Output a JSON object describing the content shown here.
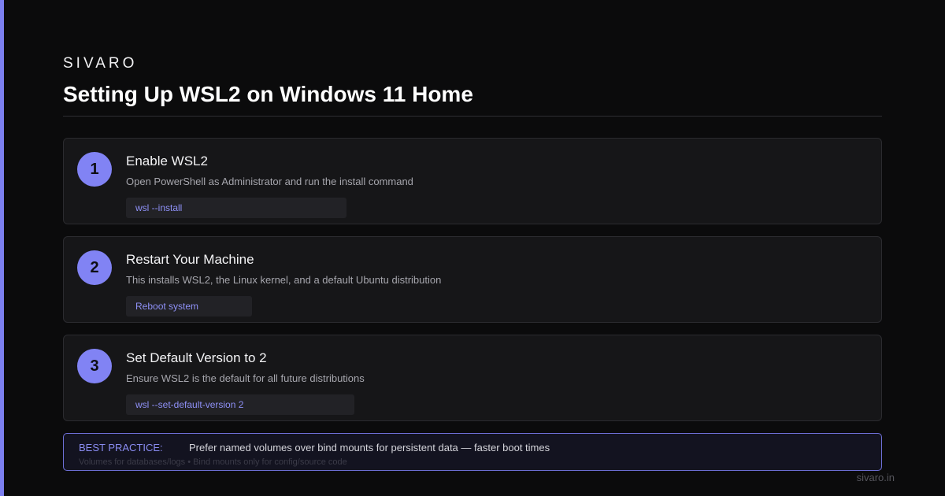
{
  "brand": "SIVARO",
  "title": "Setting Up WSL2 on Windows 11 Home",
  "steps": [
    {
      "number": "1",
      "title": "Enable WSL2",
      "description": "Open PowerShell as Administrator and run the install command",
      "code": "wsl --install"
    },
    {
      "number": "2",
      "title": "Restart Your Machine",
      "description": "This installs WSL2, the Linux kernel, and a default Ubuntu distribution",
      "code": "Reboot system"
    },
    {
      "number": "3",
      "title": "Set Default Version to 2",
      "description": "Ensure WSL2 is the default for all future distributions",
      "code": "wsl --set-default-version 2"
    }
  ],
  "callout": {
    "label": "BEST PRACTICE:",
    "text": "Prefer named volumes over bind mounts for persistent data — faster boot times",
    "subtext": "Volumes for databases/logs • Bind mounts only for config/source code"
  },
  "footer": "sivaro.in",
  "colors": {
    "accent": "#8183f4",
    "background": "#0b0b0c",
    "card": "#161618",
    "code_text": "#8e90f6"
  }
}
